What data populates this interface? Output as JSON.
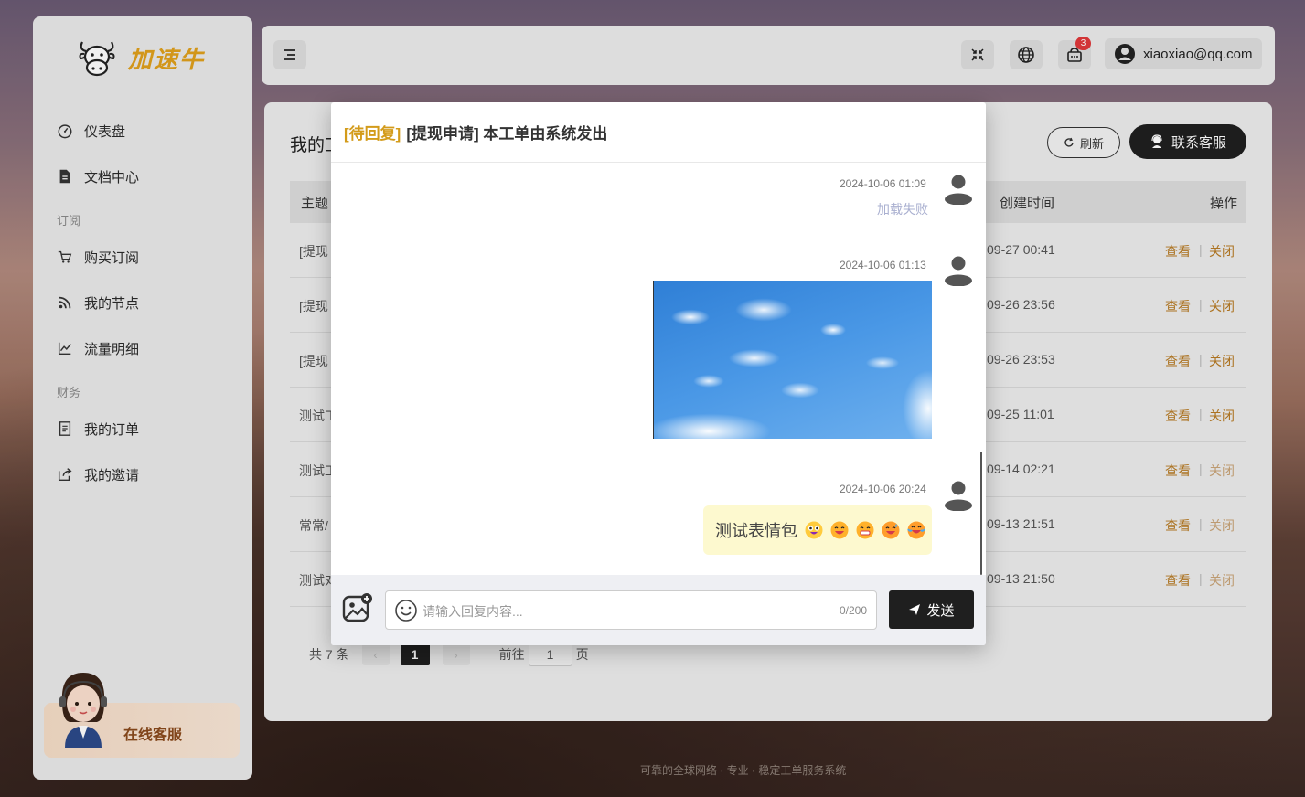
{
  "brand": {
    "name": "加速牛",
    "accent": "#e0a01c"
  },
  "sidebar": {
    "items": [
      {
        "label": "仪表盘",
        "icon": "dashboard-icon"
      },
      {
        "label": "文档中心",
        "icon": "document-icon"
      }
    ],
    "group_subscription": "订阅",
    "subscription_items": [
      {
        "label": "购买订阅",
        "icon": "cart-icon"
      },
      {
        "label": "我的节点",
        "icon": "rss-icon"
      },
      {
        "label": "流量明细",
        "icon": "chart-line-icon"
      }
    ],
    "group_finance": "财务",
    "finance_items": [
      {
        "label": "我的订单",
        "icon": "order-icon"
      },
      {
        "label": "我的邀请",
        "icon": "share-icon"
      }
    ],
    "support_label": "在线客服"
  },
  "topbar": {
    "cart_badge": "3",
    "user_email": "xiaoxiao@qq.com"
  },
  "main": {
    "title": "我的工单",
    "refresh_label": "刷新",
    "contact_label": "联系客服",
    "table": {
      "headers": {
        "subject": "主题",
        "created": "创建时间",
        "ops": "操作"
      },
      "rows": [
        {
          "subject": "[提现",
          "time": "09-27 00:41",
          "view": "查看",
          "close": "关闭",
          "close_dim": false
        },
        {
          "subject": "[提现",
          "time": "09-26 23:56",
          "view": "查看",
          "close": "关闭",
          "close_dim": false
        },
        {
          "subject": "[提现",
          "time": "09-26 23:53",
          "view": "查看",
          "close": "关闭",
          "close_dim": false
        },
        {
          "subject": "测试工",
          "time": "09-25 11:01",
          "view": "查看",
          "close": "关闭",
          "close_dim": false
        },
        {
          "subject": "测试工",
          "time": "09-14 02:21",
          "view": "查看",
          "close": "关闭",
          "close_dim": true
        },
        {
          "subject": "常常/",
          "time": "09-13 21:51",
          "view": "查看",
          "close": "关闭",
          "close_dim": true
        },
        {
          "subject": "测试对",
          "time": "09-13 21:50",
          "view": "查看",
          "close": "关闭",
          "close_dim": true
        }
      ]
    },
    "pager": {
      "total": "共 7 条",
      "current": "1",
      "goto_label": "前往",
      "goto_value": "1",
      "page_suffix": "页"
    },
    "footer": "可靠的全球网络 · 专业 · 稳定工单服务系统"
  },
  "modal": {
    "status": "[待回复]",
    "title": "[提现申请] 本工单由系统发出",
    "messages": [
      {
        "time": "2024-10-06 01:09",
        "text": "加载失败"
      },
      {
        "time": "2024-10-06 01:13"
      },
      {
        "time": "2024-10-06 20:24",
        "text": "测试表情包"
      }
    ],
    "reply_placeholder": "请输入回复内容...",
    "counter": "0/200",
    "send_label": "发送"
  }
}
